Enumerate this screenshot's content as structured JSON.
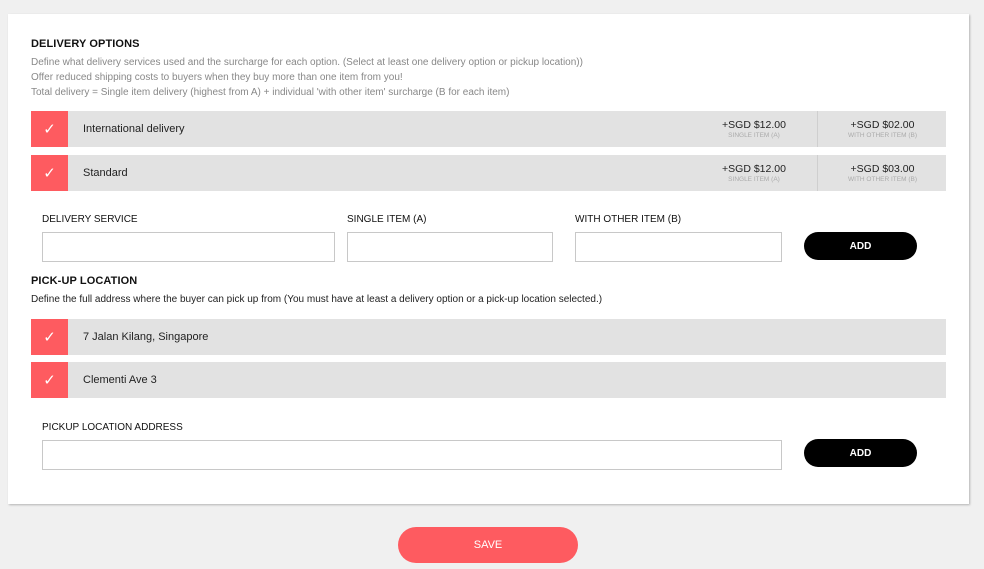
{
  "delivery": {
    "title": "DELIVERY OPTIONS",
    "desc": [
      "Define what delivery services used and the surcharge for each option. (Select at least one delivery option or pickup location))",
      "Offer reduced shipping costs to buyers when they buy more than one item from you!",
      "Total delivery = Single item delivery (highest from A) + individual 'with other item' surcharge (B for each item)"
    ],
    "options": [
      {
        "label": "International delivery",
        "single_price": "+SGD $12.00",
        "single_sub": "SINGLE ITEM (A)",
        "other_price": "+SGD $02.00",
        "other_sub": "WITH OTHER ITEM (B)",
        "checked": true
      },
      {
        "label": "Standard",
        "single_price": "+SGD $12.00",
        "single_sub": "SINGLE ITEM (A)",
        "other_price": "+SGD $03.00",
        "other_sub": "WITH OTHER ITEM (B)",
        "checked": true
      }
    ],
    "form": {
      "service_label": "DELIVERY SERVICE",
      "single_label": "SINGLE ITEM (A)",
      "other_label": "WITH OTHER ITEM (B)",
      "add_label": "ADD"
    }
  },
  "pickup": {
    "title": "PICK-UP LOCATION",
    "desc": "Define the full address where the buyer can pick up from (You must have at least a delivery option or a pick-up location selected.)",
    "locations": [
      {
        "label": "7 Jalan Kilang, Singapore",
        "checked": true
      },
      {
        "label": "Clementi Ave 3",
        "checked": true
      }
    ],
    "form": {
      "address_label": "PICKUP LOCATION ADDRESS",
      "add_label": "ADD"
    }
  },
  "save_label": "SAVE",
  "check_glyph": "✓",
  "colors": {
    "accent": "#fe5b60",
    "row_bg": "#e2e2e2",
    "button": "#000000"
  }
}
